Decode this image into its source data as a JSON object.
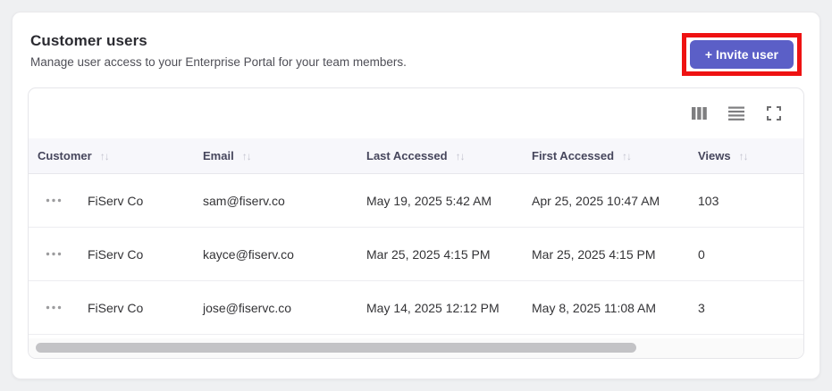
{
  "page": {
    "title": "Customer users",
    "subtitle": "Manage user access to your Enterprise Portal for your team members."
  },
  "actions": {
    "invite_label": "+ Invite user"
  },
  "icons": {
    "sort": "↑↓",
    "row_menu": "•••"
  },
  "colors": {
    "accent": "#5b5fc7",
    "annotation_highlight": "#ee1212",
    "header_bg": "#f7f7fb"
  },
  "table": {
    "columns": [
      {
        "label": "Customer",
        "sortable": true
      },
      {
        "label": "Email",
        "sortable": true
      },
      {
        "label": "Last Accessed",
        "sortable": true
      },
      {
        "label": "First Accessed",
        "sortable": true
      },
      {
        "label": "Views",
        "sortable": true
      }
    ],
    "rows": [
      {
        "customer": "FiServ Co",
        "email": "sam@fiserv.co",
        "last_accessed": "May 19, 2025 5:42 AM",
        "first_accessed": "Apr 25, 2025 10:47 AM",
        "views": "103"
      },
      {
        "customer": "FiServ Co",
        "email": "kayce@fiserv.co",
        "last_accessed": "Mar 25, 2025 4:15 PM",
        "first_accessed": "Mar 25, 2025 4:15 PM",
        "views": "0"
      },
      {
        "customer": "FiServ Co",
        "email": "jose@fiservc.co",
        "last_accessed": "May 14, 2025 12:12 PM",
        "first_accessed": "May 8, 2025 11:08 AM",
        "views": "3"
      }
    ]
  }
}
